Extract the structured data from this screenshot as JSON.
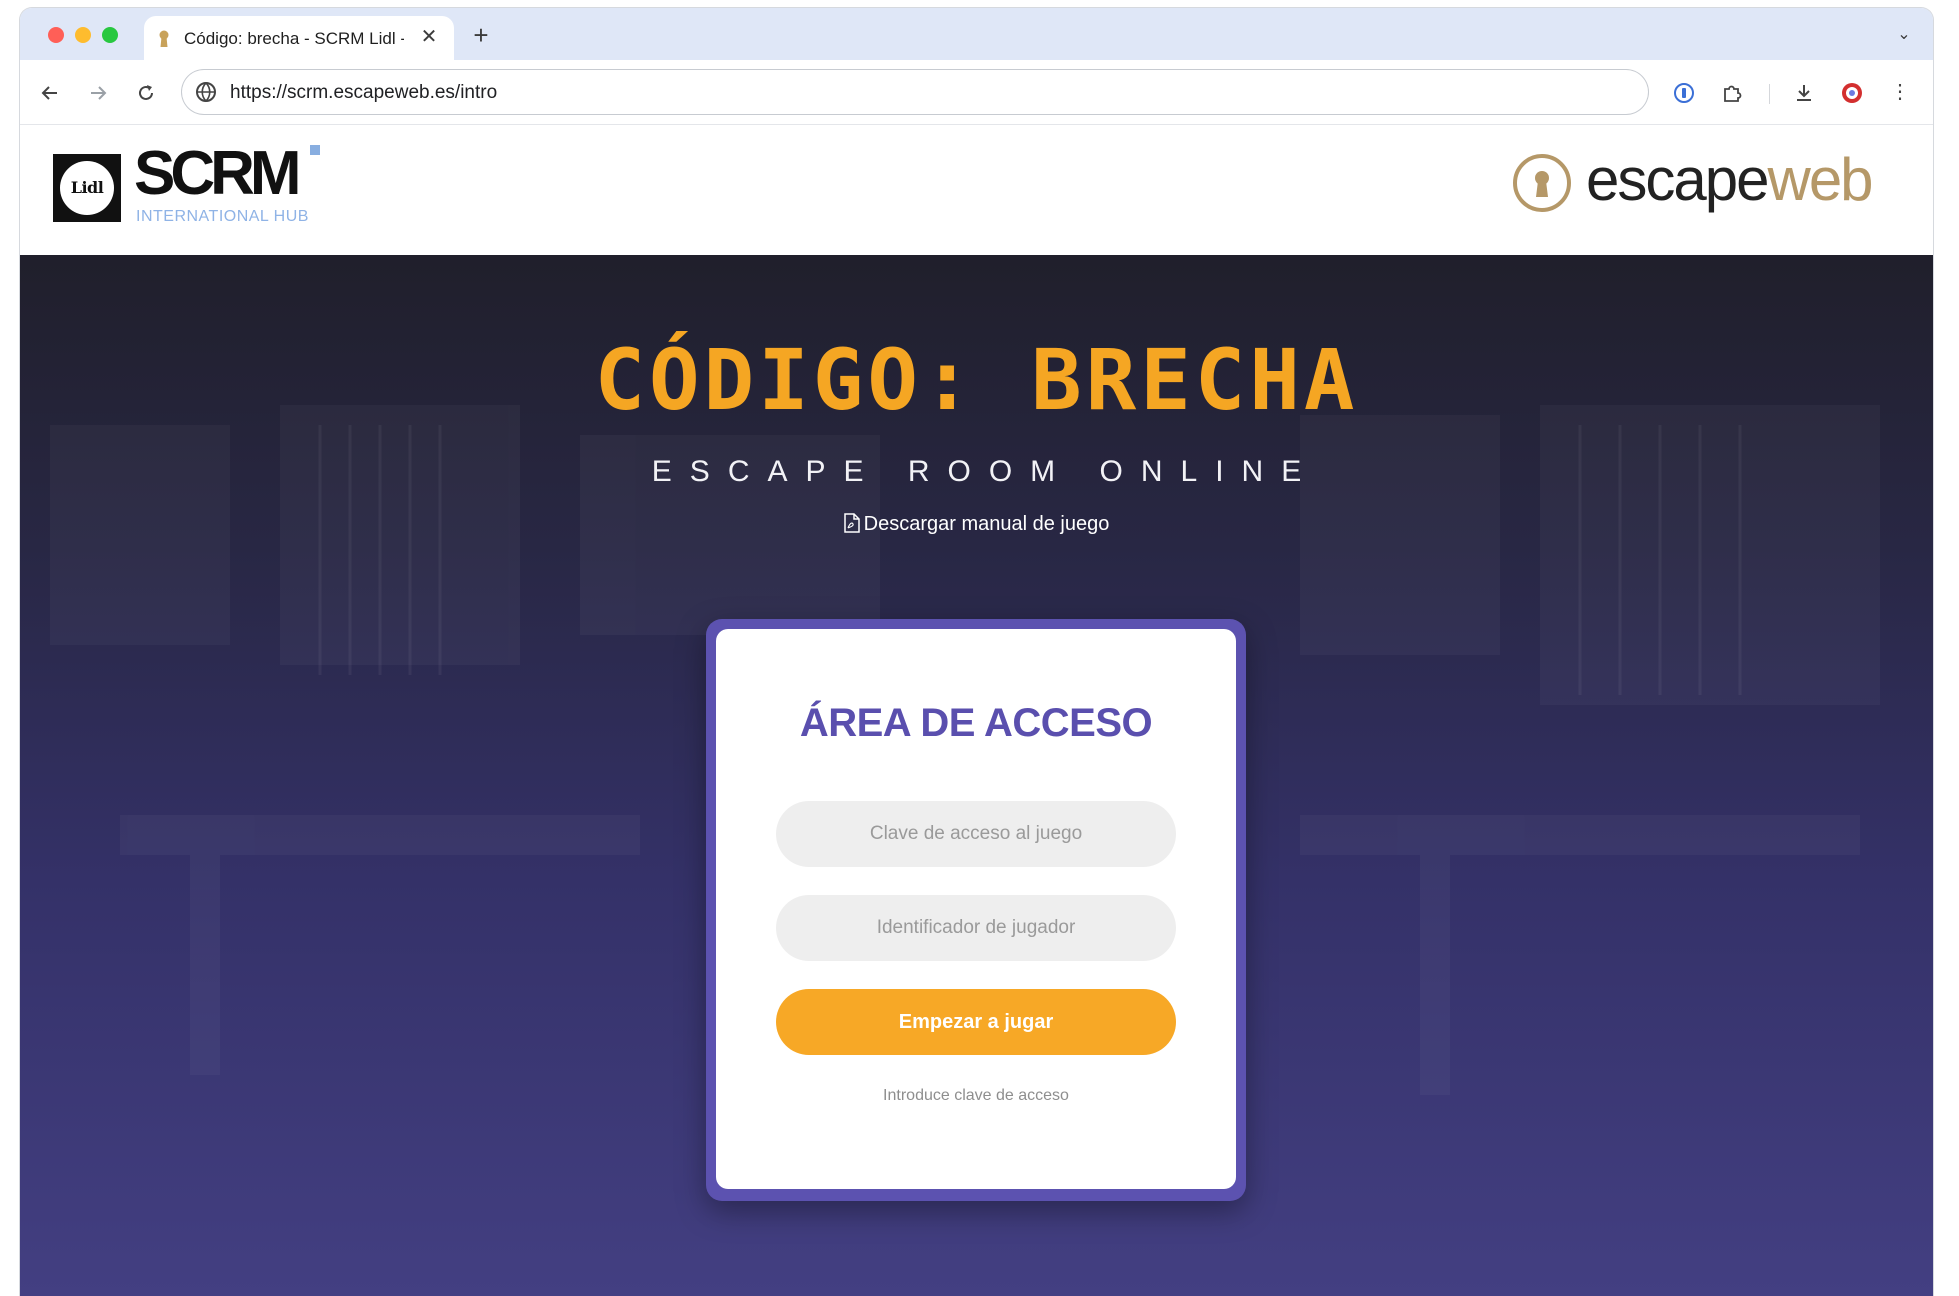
{
  "browser": {
    "tab": {
      "title": "Código: brecha - SCRM Lidl -"
    },
    "address_bar": {
      "url": "https://scrm.escapeweb.es/intro"
    },
    "icons": {
      "back": "arrow-left-icon",
      "forward": "arrow-right-icon",
      "reload": "reload-icon",
      "site_info": "site-info-icon",
      "close_tab": "close-icon",
      "new_tab": "plus-icon",
      "tab_search": "chevron-down-icon",
      "password_manager": "password-manager-icon",
      "extensions": "puzzle-icon",
      "downloads": "download-icon",
      "extension_red": "target-extension-icon",
      "menu": "kebab-menu-icon"
    }
  },
  "header": {
    "left_logo": {
      "brand": "Lidl",
      "word": "SCRM",
      "subtitle": "INTERNATIONAL HUB"
    },
    "right_logo": {
      "word_dark": "escape",
      "word_gold": "web"
    }
  },
  "hero": {
    "title": "CÓDIGO: BRECHA",
    "subtitle": "ESCAPE ROOM ONLINE",
    "manual_link": "Descargar manual de juego"
  },
  "login": {
    "title": "ÁREA DE ACCESO",
    "access_key": {
      "value": "",
      "placeholder": "Clave de acceso al juego"
    },
    "player_id": {
      "value": "",
      "placeholder": "Identificador de jugador"
    },
    "start_button": "Empezar a jugar",
    "hint": "Introduce clave de acceso"
  },
  "colors": {
    "accent_orange": "#f5a623",
    "card_purple": "#5c52b0",
    "title_purple": "#5a4fae",
    "escapeweb_gold": "#b59868",
    "scrm_blue": "#8fb3e6"
  }
}
